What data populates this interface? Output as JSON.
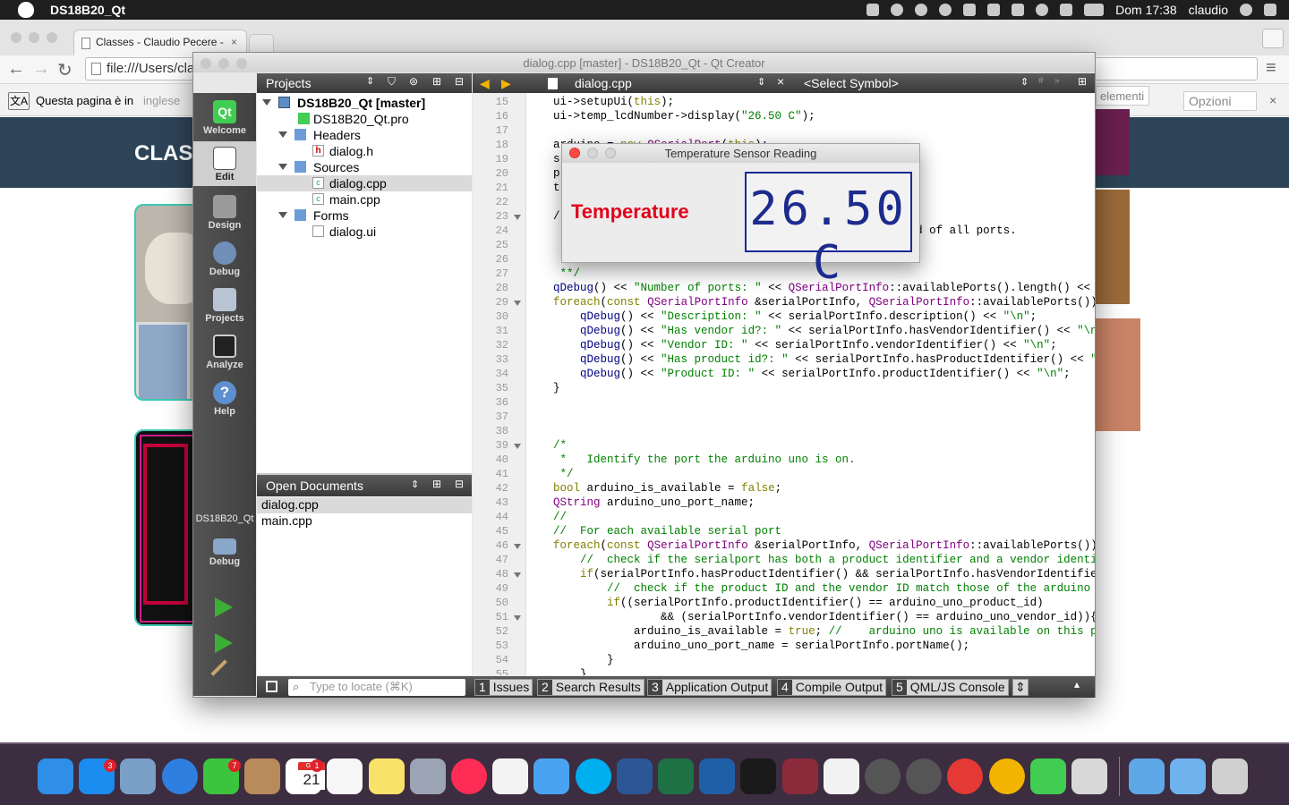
{
  "menubar": {
    "app_name": "DS18B20_Qt",
    "clock": "Dom 17:38",
    "user": "claudio"
  },
  "browser": {
    "tab_title": "Classes - Claudio Pecere -",
    "url": "file:///Users/cla",
    "translate_text": "Questa pagina è in",
    "translate_lang": "inglese",
    "elements_text": "elementi",
    "options_label": "Opzioni",
    "site_title": "CLAS"
  },
  "qt": {
    "window_title": "dialog.cpp [master] - DS18B20_Qt - Qt Creator",
    "projects_label": "Projects",
    "open_docs_label": "Open Documents",
    "editor_file": "dialog.cpp",
    "symbol_select": "<Select Symbol>",
    "modes": [
      {
        "label": "Welcome",
        "icon": "qt-logo-icon"
      },
      {
        "label": "Edit",
        "icon": "edit-document-icon"
      },
      {
        "label": "Design",
        "icon": "design-tools-icon"
      },
      {
        "label": "Debug",
        "icon": "debug-icon"
      },
      {
        "label": "Projects",
        "icon": "projects-icon"
      },
      {
        "label": "Analyze",
        "icon": "analyze-icon"
      },
      {
        "label": "Help",
        "icon": "help-icon"
      }
    ],
    "kit_label": "DS18B20_Qt",
    "kit_build": "Debug",
    "tree": [
      {
        "label": "DS18B20_Qt [master]"
      },
      {
        "label": "DS18B20_Qt.pro"
      },
      {
        "label": "Headers"
      },
      {
        "label": "dialog.h"
      },
      {
        "label": "Sources"
      },
      {
        "label": "dialog.cpp"
      },
      {
        "label": "main.cpp"
      },
      {
        "label": "Forms"
      },
      {
        "label": "dialog.ui"
      }
    ],
    "open_docs": [
      "dialog.cpp",
      "main.cpp"
    ],
    "locate_placeholder": "Type to locate (⌘K)",
    "panes": [
      {
        "num": "1",
        "label": "Issues"
      },
      {
        "num": "2",
        "label": "Search Results"
      },
      {
        "num": "3",
        "label": "Application Output"
      },
      {
        "num": "4",
        "label": "Compile Output"
      },
      {
        "num": "5",
        "label": "QML/JS Console"
      }
    ],
    "line_numbers": [
      "15",
      "16",
      "17",
      "18",
      "19",
      "20",
      "21",
      "22",
      "23",
      "24",
      "25",
      "26",
      "27",
      "28",
      "29",
      "30",
      "31",
      "32",
      "33",
      "34",
      "35",
      "36",
      "37",
      "38",
      "39",
      "40",
      "41",
      "42",
      "43",
      "44",
      "45",
      "46",
      "47",
      "48",
      "49",
      "50",
      "51",
      "52",
      "53",
      "54",
      "55"
    ],
    "code_lines": [
      "    ui->setupUi(this);",
      "    ui->temp_lcdNumber->display(\"26.50 C\");",
      "",
      "    arduino = new QSerialPort(this);",
      "    s",
      "    p",
      "    t",
      "",
      "    /",
      "                                                 product id of all ports.",
      "",
      "",
      "     **/",
      "    qDebug() << \"Number of ports: \" << QSerialPortInfo::availablePorts().length() << \"\\n\";",
      "    foreach(const QSerialPortInfo &serialPortInfo, QSerialPortInfo::availablePorts()){",
      "        qDebug() << \"Description: \" << serialPortInfo.description() << \"\\n\";",
      "        qDebug() << \"Has vendor id?: \" << serialPortInfo.hasVendorIdentifier() << \"\\n\";",
      "        qDebug() << \"Vendor ID: \" << serialPortInfo.vendorIdentifier() << \"\\n\";",
      "        qDebug() << \"Has product id?: \" << serialPortInfo.hasProductIdentifier() << \"\\n\";",
      "        qDebug() << \"Product ID: \" << serialPortInfo.productIdentifier() << \"\\n\";",
      "    }",
      "",
      "",
      "",
      "    /*",
      "     *   Identify the port the arduino uno is on.",
      "     */",
      "    bool arduino_is_available = false;",
      "    QString arduino_uno_port_name;",
      "    //",
      "    //  For each available serial port",
      "    foreach(const QSerialPortInfo &serialPortInfo, QSerialPortInfo::availablePorts()){",
      "        //  check if the serialport has both a product identifier and a vendor identifier",
      "        if(serialPortInfo.hasProductIdentifier() && serialPortInfo.hasVendorIdentifier()){",
      "            //  check if the product ID and the vendor ID match those of the arduino uno",
      "            if((serialPortInfo.productIdentifier() == arduino_uno_product_id)",
      "                    && (serialPortInfo.vendorIdentifier() == arduino_uno_vendor_id)){",
      "                arduino_is_available = true; //    arduino uno is available on this port",
      "                arduino_uno_port_name = serialPortInfo.portName();",
      "            }",
      "        }"
    ],
    "fold_lines": [
      "23",
      "29",
      "39",
      "46",
      "48",
      "51"
    ]
  },
  "dialog": {
    "title": "Temperature Sensor Reading",
    "label": "Temperature",
    "lcd_value": "26.50 C"
  },
  "dock": {
    "badges": [
      "3",
      "7",
      "1"
    ],
    "calendar_month": "GIU",
    "calendar_day": "21",
    "items": [
      "finder-icon",
      "app-store-icon",
      "preview-icon",
      "safari-icon",
      "facetime-icon",
      "contacts-icon",
      "calendar-icon",
      "reminders-icon",
      "notes-icon",
      "photo-booth-icon",
      "itunes-icon",
      "photos-icon",
      "messages-icon",
      "skype-icon",
      "word-icon",
      "excel-icon",
      "xcode-icon",
      "terminal-icon",
      "winrar-icon",
      "textedit-icon",
      "inkscape-icon",
      "inkscape-icon",
      "chrome-icon",
      "chrome-canary-icon",
      "qt-creator-icon",
      "editor-icon",
      "downloads-folder-icon",
      "folder-icon",
      "trash-icon"
    ]
  }
}
